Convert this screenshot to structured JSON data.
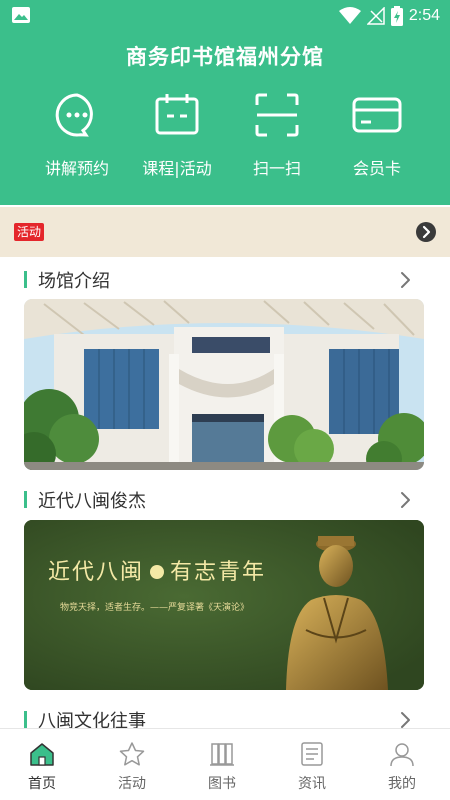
{
  "status_bar": {
    "time": "2:54"
  },
  "header": {
    "title": "商务印书馆福州分馆"
  },
  "quick_actions": [
    {
      "label": "讲解预约",
      "icon": "chat-bubble-icon"
    },
    {
      "label": "课程|活动",
      "icon": "calendar-icon"
    },
    {
      "label": "扫一扫",
      "icon": "scan-icon"
    },
    {
      "label": "会员卡",
      "icon": "card-icon"
    }
  ],
  "activity": {
    "tag": "活动"
  },
  "sections": [
    {
      "title": "场馆介绍"
    },
    {
      "title": "近代八闽俊杰",
      "banner_title_left": "近代八闽",
      "banner_title_right": "有志青年",
      "banner_subtitle": "物竞天择，适者生存。——严复译著《天演论》"
    },
    {
      "title": "八闽文化往事"
    }
  ],
  "bottom_nav": [
    {
      "label": "首页",
      "icon": "home-icon",
      "active": true
    },
    {
      "label": "活动",
      "icon": "star-icon",
      "active": false
    },
    {
      "label": "图书",
      "icon": "books-icon",
      "active": false
    },
    {
      "label": "资讯",
      "icon": "news-icon",
      "active": false
    },
    {
      "label": "我的",
      "icon": "user-icon",
      "active": false
    }
  ],
  "colors": {
    "brand": "#3bbf8b",
    "activity_bg": "#f1e8d7",
    "tag_red": "#e4262b",
    "banner_green": "#3e5a2c"
  }
}
